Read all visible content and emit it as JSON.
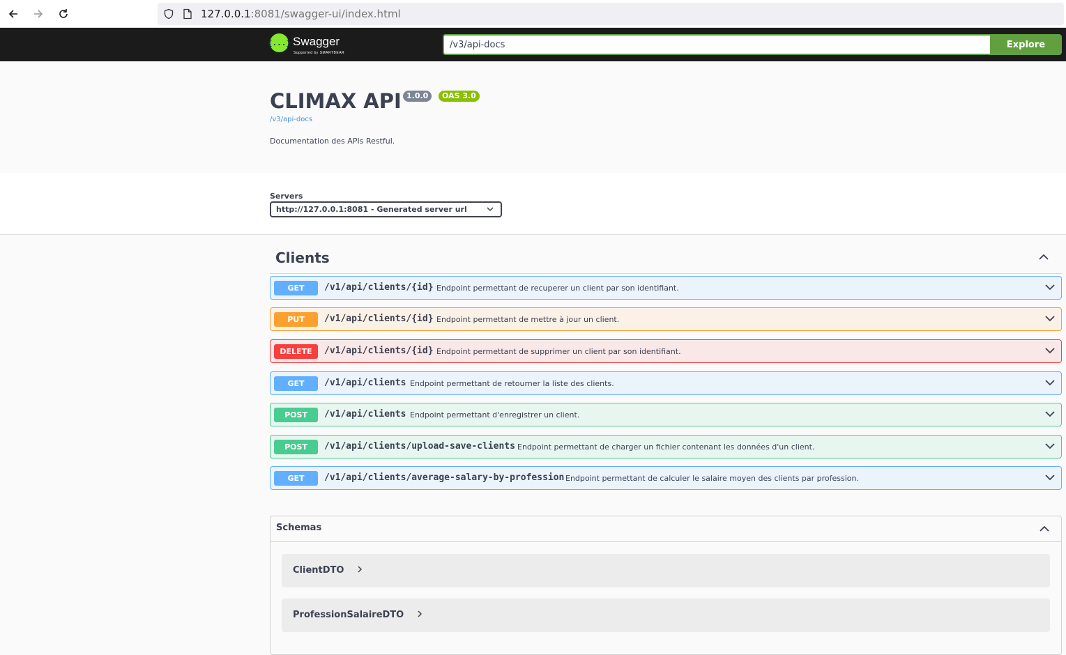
{
  "browser": {
    "url_host": "127.0.0.1",
    "url_rest": ":8081/swagger-ui/index.html"
  },
  "topbar": {
    "logo_text": "Swagger",
    "logo_sub": "Supported by SMARTBEAR",
    "logo_symbol": "{...}",
    "spec_url": "/v3/api-docs",
    "explore_label": "Explore"
  },
  "info": {
    "title": "CLIMAX API",
    "version": "1.0.0",
    "oas": "OAS 3.0",
    "spec_link": "/v3/api-docs",
    "description": "Documentation des APIs Restful."
  },
  "servers": {
    "label": "Servers",
    "selected": "http://127.0.0.1:8081 - Generated server url"
  },
  "tag": {
    "name": "Clients"
  },
  "operations": [
    {
      "method": "GET",
      "path": "/v1/api/clients/{id}",
      "summary": "Endpoint permettant de recuperer un client par son identifiant."
    },
    {
      "method": "PUT",
      "path": "/v1/api/clients/{id}",
      "summary": "Endpoint permettant de mettre à jour un client."
    },
    {
      "method": "DELETE",
      "path": "/v1/api/clients/{id}",
      "summary": "Endpoint permettant de supprimer un client par son identifiant."
    },
    {
      "method": "GET",
      "path": "/v1/api/clients",
      "summary": "Endpoint permettant de retourner la liste des clients."
    },
    {
      "method": "POST",
      "path": "/v1/api/clients",
      "summary": "Endpoint permettant d'enregistrer un client."
    },
    {
      "method": "POST",
      "path": "/v1/api/clients/upload-save-clients",
      "summary": "Endpoint permettant de charger un fichier contenant les données d'un client."
    },
    {
      "method": "GET",
      "path": "/v1/api/clients/average-salary-by-profession",
      "summary": "Endpoint permettant de calculer le salaire moyen des clients par profession."
    }
  ],
  "schemas": {
    "title": "Schemas",
    "models": [
      "ClientDTO",
      "ProfessionSalaireDTO"
    ]
  },
  "colors": {
    "get": "#61affe",
    "put": "#fca130",
    "delete": "#f93e3e",
    "post": "#49cc90",
    "topbar": "#1b1b1b",
    "explore": "#62a03f"
  }
}
